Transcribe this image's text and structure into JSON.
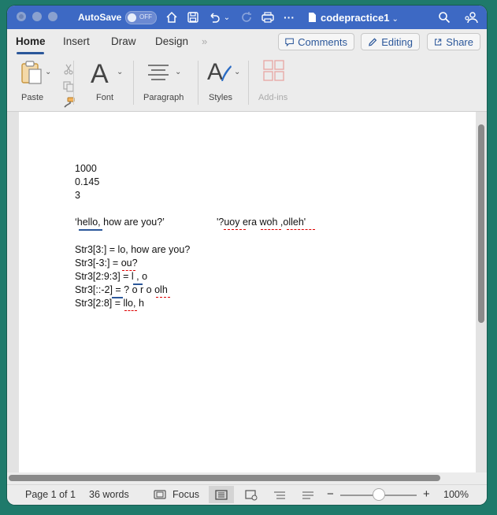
{
  "titlebar": {
    "autosave_label": "AutoSave",
    "autosave_state": "OFF",
    "doc_title": "codepractice1"
  },
  "ribbon": {
    "tabs": [
      "Home",
      "Insert",
      "Draw",
      "Design"
    ],
    "active_tab": "Home",
    "comments_label": "Comments",
    "editing_label": "Editing",
    "share_label": "Share",
    "groups": {
      "paste": "Paste",
      "font": "Font",
      "paragraph": "Paragraph",
      "styles": "Styles",
      "addins": "Add-ins"
    },
    "accent": "#2b579a"
  },
  "document": {
    "lines": [
      "1000",
      "0.145",
      "3",
      "‘hello, how are you?’",
      "'?uoy era woh ,olleh'",
      "Str3[3:] = lo, how are you?",
      "Str3[-3:] = ou?",
      "Str3[2:9:3] = l , o",
      "Str3[::-2] = ? o r o olh",
      "Str3[2:8] = llo, h"
    ]
  },
  "statusbar": {
    "page": "Page 1 of 1",
    "words": "36 words",
    "focus": "Focus",
    "zoom": "100%",
    "zoom_minus": "−",
    "zoom_plus": "+"
  },
  "colors": {
    "titlebar": "#3d69c4",
    "background": "#1f7a6b"
  }
}
